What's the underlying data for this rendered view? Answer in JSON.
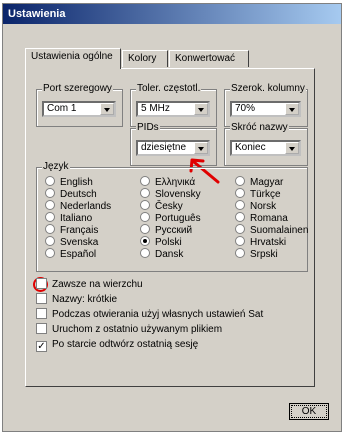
{
  "window": {
    "title": "Ustawienia"
  },
  "tabs": [
    {
      "label": "Ustawienia ogólne"
    },
    {
      "label": "Kolory"
    },
    {
      "label": "Konwertować"
    }
  ],
  "port": {
    "label": "Port szeregowy",
    "value": "Com 1"
  },
  "freq": {
    "label": "Toler. częstotl.",
    "value": "5 MHz"
  },
  "width": {
    "label": "Szerok. kolumny",
    "value": "70%"
  },
  "pids": {
    "label": "PIDs",
    "value": "dziesiętne"
  },
  "shortname": {
    "label": "Skróć nazwy",
    "value": "Koniec"
  },
  "language": {
    "label": "Język",
    "col1": [
      "English",
      "Deutsch",
      "Nederlands",
      "Italiano",
      "Français",
      "Svenska",
      "Español"
    ],
    "col2": [
      "Ελληνικά",
      "Slovensky",
      "Česky",
      "Português",
      "Русский",
      "Polski",
      "Dansk"
    ],
    "col3": [
      "Magyar",
      "Türkçe",
      "Norsk",
      "Romana",
      "Suomalainen",
      "Hrvatski",
      "Srpski"
    ],
    "selected": "Polski"
  },
  "options": [
    {
      "label": "Zawsze na wierzchu",
      "checked": false
    },
    {
      "label": "Nazwy: krótkie",
      "checked": false
    },
    {
      "label": "Podczas otwierania użyj własnych ustawień Sat",
      "checked": false
    },
    {
      "label": "Uruchom z ostatnio używanym plikiem",
      "checked": false
    },
    {
      "label": "Po starcie odtwórz ostatnią sesję",
      "checked": true
    }
  ],
  "ok_button": {
    "label": "OK"
  },
  "annotation_colors": {
    "highlight": "#e00000"
  }
}
